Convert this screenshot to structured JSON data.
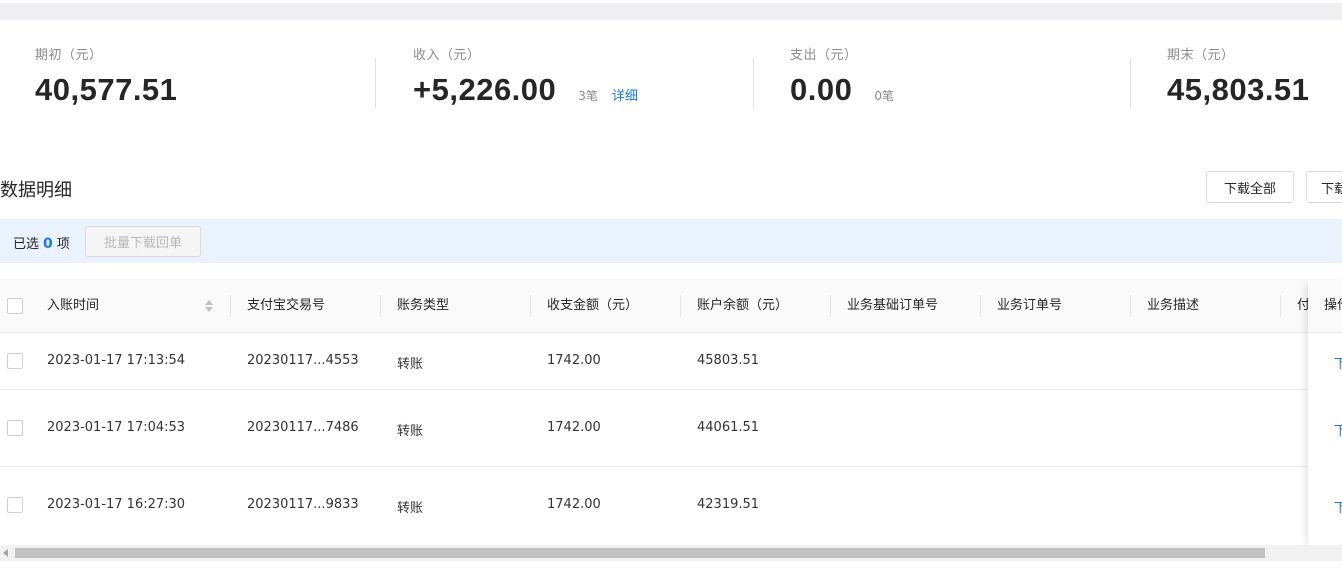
{
  "summary": {
    "opening": {
      "label": "期初（元）",
      "value": "40,577.51"
    },
    "income": {
      "label": "收入（元）",
      "value": "+5,226.00",
      "count": "3笔",
      "link": "详细"
    },
    "expense": {
      "label": "支出（元）",
      "value": "0.00",
      "count": "0笔"
    },
    "closing": {
      "label": "期末（元）",
      "value": "45,803.51"
    }
  },
  "section": {
    "title": "数据明细",
    "download_all_label": "下载全部",
    "download_label_partial": "下载"
  },
  "selection": {
    "prefix": "已选",
    "count": "0",
    "suffix": "项",
    "batch_button": "批量下载回单"
  },
  "table": {
    "columns": [
      "入账时间",
      "支付宝交易号",
      "账务类型",
      "收支金额（元）",
      "账户余额（元）",
      "业务基础订单号",
      "业务订单号",
      "业务描述",
      "付",
      "操作"
    ],
    "rows": [
      {
        "time": "2023-01-17 17:13:54",
        "trade_no": "20230117...4553",
        "type": "转账",
        "amount": "1742.00",
        "balance": "45803.51",
        "action": "下"
      },
      {
        "time": "2023-01-17 17:04:53",
        "trade_no": "20230117...7486",
        "type": "转账",
        "amount": "1742.00",
        "balance": "44061.51",
        "action": "下"
      },
      {
        "time": "2023-01-17 16:27:30",
        "trade_no": "20230117...9833",
        "type": "转账",
        "amount": "1742.00",
        "balance": "42319.51",
        "action": "下"
      }
    ]
  },
  "colors": {
    "accent": "#1677ff",
    "selection_bg": "#eaf2fe"
  },
  "icons": {
    "sort": "sort-icon",
    "scroll_left": "arrow-left-icon"
  }
}
